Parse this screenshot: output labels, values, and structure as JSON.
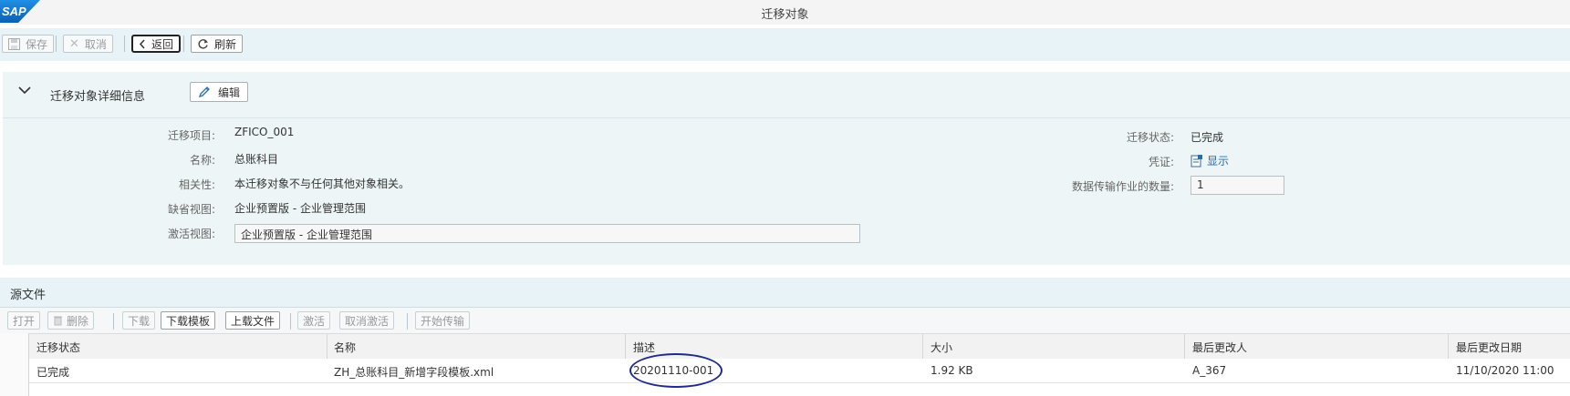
{
  "titlebar": {
    "logo": "SAP",
    "title": "迁移对象"
  },
  "toolbar": {
    "save": {
      "label": "保存",
      "icon": "save-icon"
    },
    "cancel": {
      "label": "取消",
      "icon": "close-icon"
    },
    "back": {
      "label": "返回",
      "icon": "chevron-left-icon"
    },
    "refresh": {
      "label": "刷新",
      "icon": "refresh-icon"
    }
  },
  "details": {
    "section_title": "迁移对象详细信息",
    "edit_label": "编辑",
    "left_fields": [
      {
        "label": "迁移项目:",
        "value": "ZFICO_001"
      },
      {
        "label": "名称:",
        "value": "总账科目"
      },
      {
        "label": "相关性:",
        "value": "本迁移对象不与任何其他对象相关。"
      },
      {
        "label": "缺省视图:",
        "value": "企业预置版 - 企业管理范围"
      },
      {
        "label": "激活视图:",
        "value": "企业预置版 - 企业管理范围"
      }
    ],
    "right_fields": [
      {
        "label": "迁移状态:",
        "value": "已完成"
      },
      {
        "label": "凭证:",
        "value": "显示"
      },
      {
        "label": "数据传输作业的数量:",
        "value": "1"
      }
    ]
  },
  "source_files": {
    "title": "源文件",
    "buttons": [
      "打开",
      "删除",
      "下载",
      "下载模板",
      "上载文件",
      "激活",
      "取消激活",
      "开始传输"
    ],
    "columns": [
      "迁移状态",
      "名称",
      "描述",
      "大小",
      "最后更改人",
      "最后更改日期"
    ],
    "rows": [
      {
        "status": "已完成",
        "name": "ZH_总账科目_新增字段模板.xml",
        "description": "20201110-001",
        "size": "1.92 KB",
        "changed_by": "A_367",
        "changed_on": "11/10/2020 11:00"
      }
    ]
  },
  "colors": {
    "sap_blue": "#0a6ed1",
    "annotation": "#1f2b8a",
    "link": "#2a6ea8"
  }
}
